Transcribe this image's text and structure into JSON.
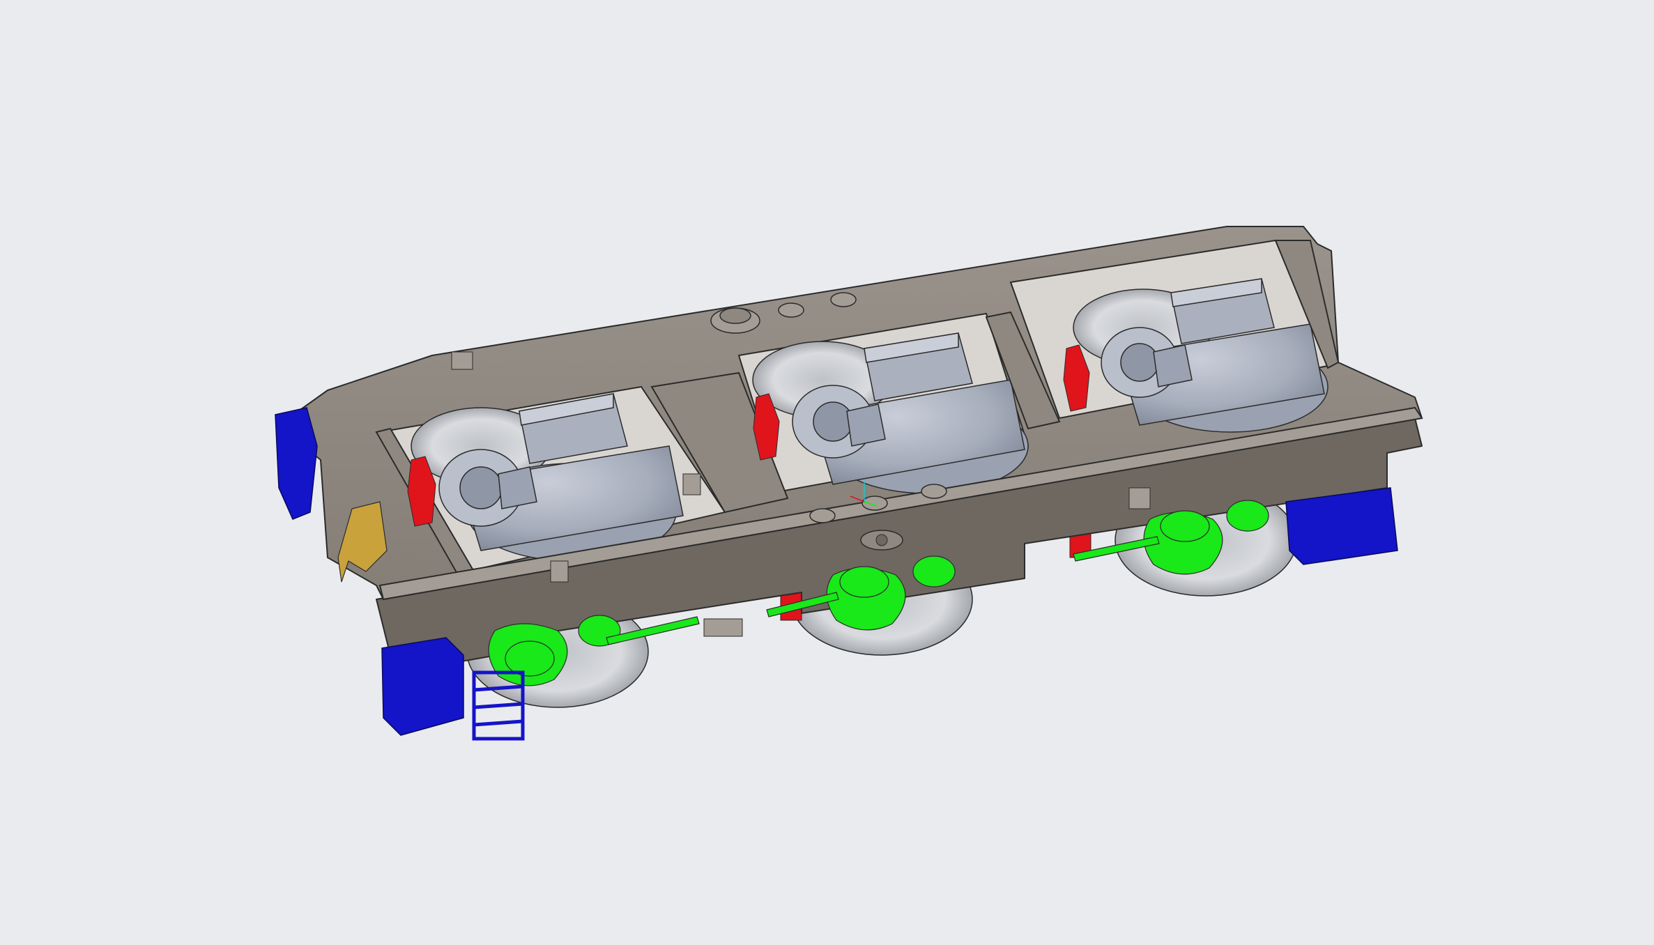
{
  "viewport": {
    "background": "#e9ebef"
  },
  "model": {
    "description_colors": {
      "frame": "#8f8880",
      "frame_light": "#a8a199",
      "frame_dark": "#6f6860",
      "motor": "#a9afbd",
      "motor_light": "#c4c9d4",
      "motor_dark": "#8d94a3",
      "wheel": "#d3d5d9",
      "wheel_dark": "#9a9ca0",
      "brake_red": "#e0141b",
      "suspension_green": "#19e819",
      "buffer_blue": "#1414c8",
      "coupler_gold": "#c9a23c",
      "edge": "#2b2b2b"
    }
  }
}
